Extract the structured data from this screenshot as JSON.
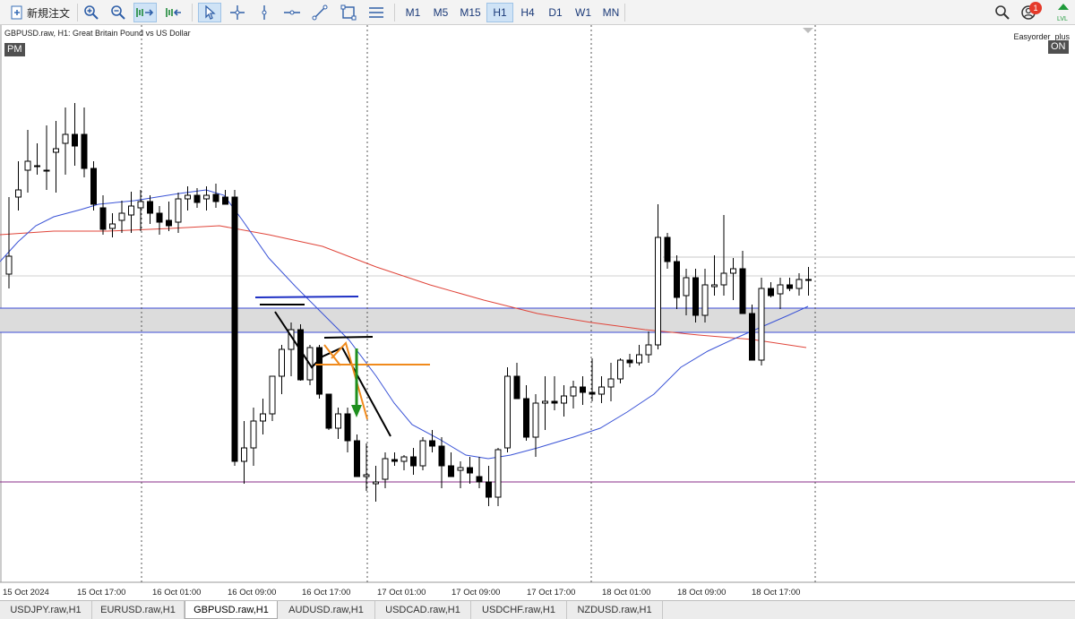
{
  "toolbar": {
    "new_order_label": "新規注文",
    "timeframes": [
      {
        "label": "M1",
        "active": false
      },
      {
        "label": "M5",
        "active": false
      },
      {
        "label": "M15",
        "active": false
      },
      {
        "label": "H1",
        "active": true
      },
      {
        "label": "H4",
        "active": false
      },
      {
        "label": "D1",
        "active": false
      },
      {
        "label": "W1",
        "active": false
      },
      {
        "label": "MN",
        "active": false
      }
    ],
    "notification_count": "1"
  },
  "chart": {
    "header": "GBPUSD.raw, H1:  Great Britain Pound vs US Dollar",
    "session_badge": "PM",
    "ea_name": "Easyorder_plus",
    "ea_status": "ON",
    "x_labels": [
      "15 Oct 2024",
      "15 Oct 17:00",
      "16 Oct 01:00",
      "16 Oct 09:00",
      "16 Oct 17:00",
      "17 Oct 01:00",
      "17 Oct 09:00",
      "17 Oct 17:00",
      "18 Oct 01:00",
      "18 Oct 09:00",
      "18 Oct 17:00"
    ],
    "colors": {
      "bull": "#ffffff",
      "bear": "#000000",
      "ma_fast": "#3a53d6",
      "ma_slow": "#e0453a",
      "zone": "#dcdcdc",
      "zone_line": "#3b4bd6",
      "support": "#8a2c8a",
      "orange": "#f08a1c",
      "arrow": "#1e8f1e",
      "blue_line": "#1e2fc4"
    }
  },
  "chart_data": {
    "type": "candlestick",
    "symbol": "GBPUSD.raw",
    "timeframe": "H1",
    "candles_y_px_note": "",
    "candles": [
      [
        306,
        220,
        322,
        286
      ],
      [
        220,
        180,
        235,
        212
      ],
      [
        190,
        145,
        215,
        180
      ],
      [
        185,
        160,
        195,
        186
      ],
      [
        190,
        140,
        212,
        190
      ],
      [
        170,
        135,
        215,
        166
      ],
      [
        160,
        120,
        195,
        150
      ],
      [
        150,
        115,
        185,
        163
      ],
      [
        150,
        120,
        198,
        188
      ],
      [
        188,
        180,
        235,
        228
      ],
      [
        232,
        218,
        262,
        256
      ],
      [
        255,
        238,
        265,
        250
      ],
      [
        246,
        224,
        260,
        238
      ],
      [
        240,
        214,
        260,
        230
      ],
      [
        232,
        212,
        258,
        225
      ],
      [
        225,
        218,
        250,
        238
      ],
      [
        238,
        230,
        262,
        248
      ],
      [
        246,
        225,
        258,
        252
      ],
      [
        248,
        215,
        260,
        222
      ],
      [
        222,
        208,
        235,
        218
      ],
      [
        218,
        210,
        232,
        226
      ],
      [
        222,
        208,
        235,
        218
      ],
      [
        217,
        205,
        232,
        225
      ],
      [
        220,
        212,
        222,
        228
      ],
      [
        220,
        212,
        520,
        515
      ],
      [
        515,
        470,
        540,
        500
      ],
      [
        500,
        455,
        520,
        470
      ],
      [
        470,
        445,
        485,
        462
      ],
      [
        462,
        420,
        470,
        420
      ],
      [
        420,
        385,
        440,
        390
      ],
      [
        390,
        360,
        420,
        368
      ],
      [
        368,
        362,
        425,
        424
      ],
      [
        424,
        385,
        430,
        388
      ],
      [
        388,
        385,
        445,
        440
      ],
      [
        440,
        440,
        480,
        478
      ],
      [
        478,
        455,
        490,
        462
      ],
      [
        462,
        455,
        505,
        492
      ],
      [
        492,
        485,
        520,
        532
      ],
      [
        532,
        495,
        548,
        530
      ],
      [
        540,
        520,
        560,
        538
      ],
      [
        535,
        505,
        545,
        512
      ],
      [
        513,
        505,
        520,
        515
      ],
      [
        515,
        508,
        525,
        510
      ],
      [
        510,
        500,
        530,
        520
      ],
      [
        520,
        488,
        525,
        492
      ],
      [
        492,
        480,
        505,
        498
      ],
      [
        498,
        488,
        545,
        520
      ],
      [
        520,
        505,
        530,
        532
      ],
      [
        525,
        515,
        545,
        522
      ],
      [
        522,
        510,
        540,
        528
      ],
      [
        532,
        510,
        545,
        538
      ],
      [
        538,
        520,
        565,
        555
      ],
      [
        555,
        500,
        565,
        502
      ],
      [
        500,
        410,
        505,
        420
      ],
      [
        420,
        405,
        435,
        445
      ],
      [
        445,
        430,
        492,
        488
      ],
      [
        488,
        440,
        510,
        450
      ],
      [
        450,
        420,
        480,
        448
      ],
      [
        448,
        420,
        458,
        450
      ],
      [
        450,
        430,
        465,
        442
      ],
      [
        442,
        425,
        456,
        432
      ],
      [
        432,
        420,
        452,
        438
      ],
      [
        438,
        400,
        448,
        440
      ],
      [
        440,
        420,
        450,
        432
      ],
      [
        432,
        405,
        448,
        423
      ],
      [
        423,
        400,
        428,
        402
      ],
      [
        402,
        395,
        410,
        405
      ],
      [
        405,
        385,
        408,
        396
      ],
      [
        396,
        370,
        405,
        385
      ],
      [
        385,
        228,
        390,
        265
      ],
      [
        265,
        260,
        300,
        292
      ],
      [
        292,
        285,
        345,
        332
      ],
      [
        330,
        300,
        352,
        310
      ],
      [
        310,
        300,
        360,
        352
      ],
      [
        352,
        300,
        360,
        318
      ],
      [
        320,
        285,
        330,
        318
      ],
      [
        318,
        240,
        330,
        305
      ],
      [
        305,
        288,
        335,
        300
      ],
      [
        300,
        280,
        345,
        350
      ],
      [
        350,
        340,
        400,
        402
      ],
      [
        402,
        310,
        408,
        322
      ],
      [
        322,
        315,
        332,
        330
      ],
      [
        328,
        310,
        345,
        318
      ],
      [
        318,
        310,
        325,
        322
      ],
      [
        322,
        305,
        330,
        312
      ],
      [
        312,
        298,
        330,
        312
      ]
    ]
  }
}
